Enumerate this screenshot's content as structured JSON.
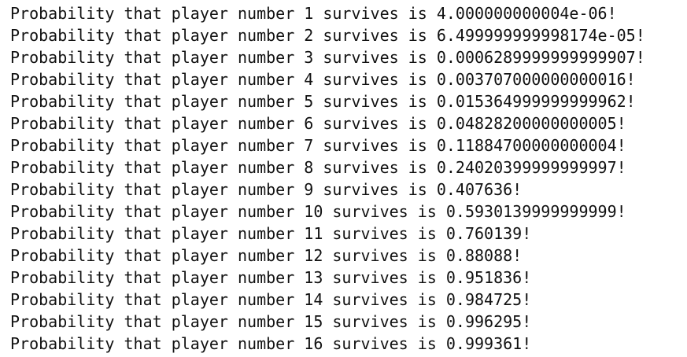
{
  "console": {
    "lines": [
      "Probability that player number 1 survives is 4.000000000004e-06!",
      "Probability that player number 2 survives is 6.499999999998174e-05!",
      "Probability that player number 3 survives is 0.0006289999999999907!",
      "Probability that player number 4 survives is 0.003707000000000016!",
      "Probability that player number 5 survives is 0.015364999999999962!",
      "Probability that player number 6 survives is 0.04828200000000005!",
      "Probability that player number 7 survives is 0.11884700000000004!",
      "Probability that player number 8 survives is 0.24020399999999997!",
      "Probability that player number 9 survives is 0.407636!",
      "Probability that player number 10 survives is 0.5930139999999999!",
      "Probability that player number 11 survives is 0.760139!",
      "Probability that player number 12 survives is 0.88088!",
      "Probability that player number 13 survives is 0.951836!",
      "Probability that player number 14 survives is 0.984725!",
      "Probability that player number 15 survives is 0.996295!",
      "Probability that player number 16 survives is 0.999361!"
    ]
  }
}
